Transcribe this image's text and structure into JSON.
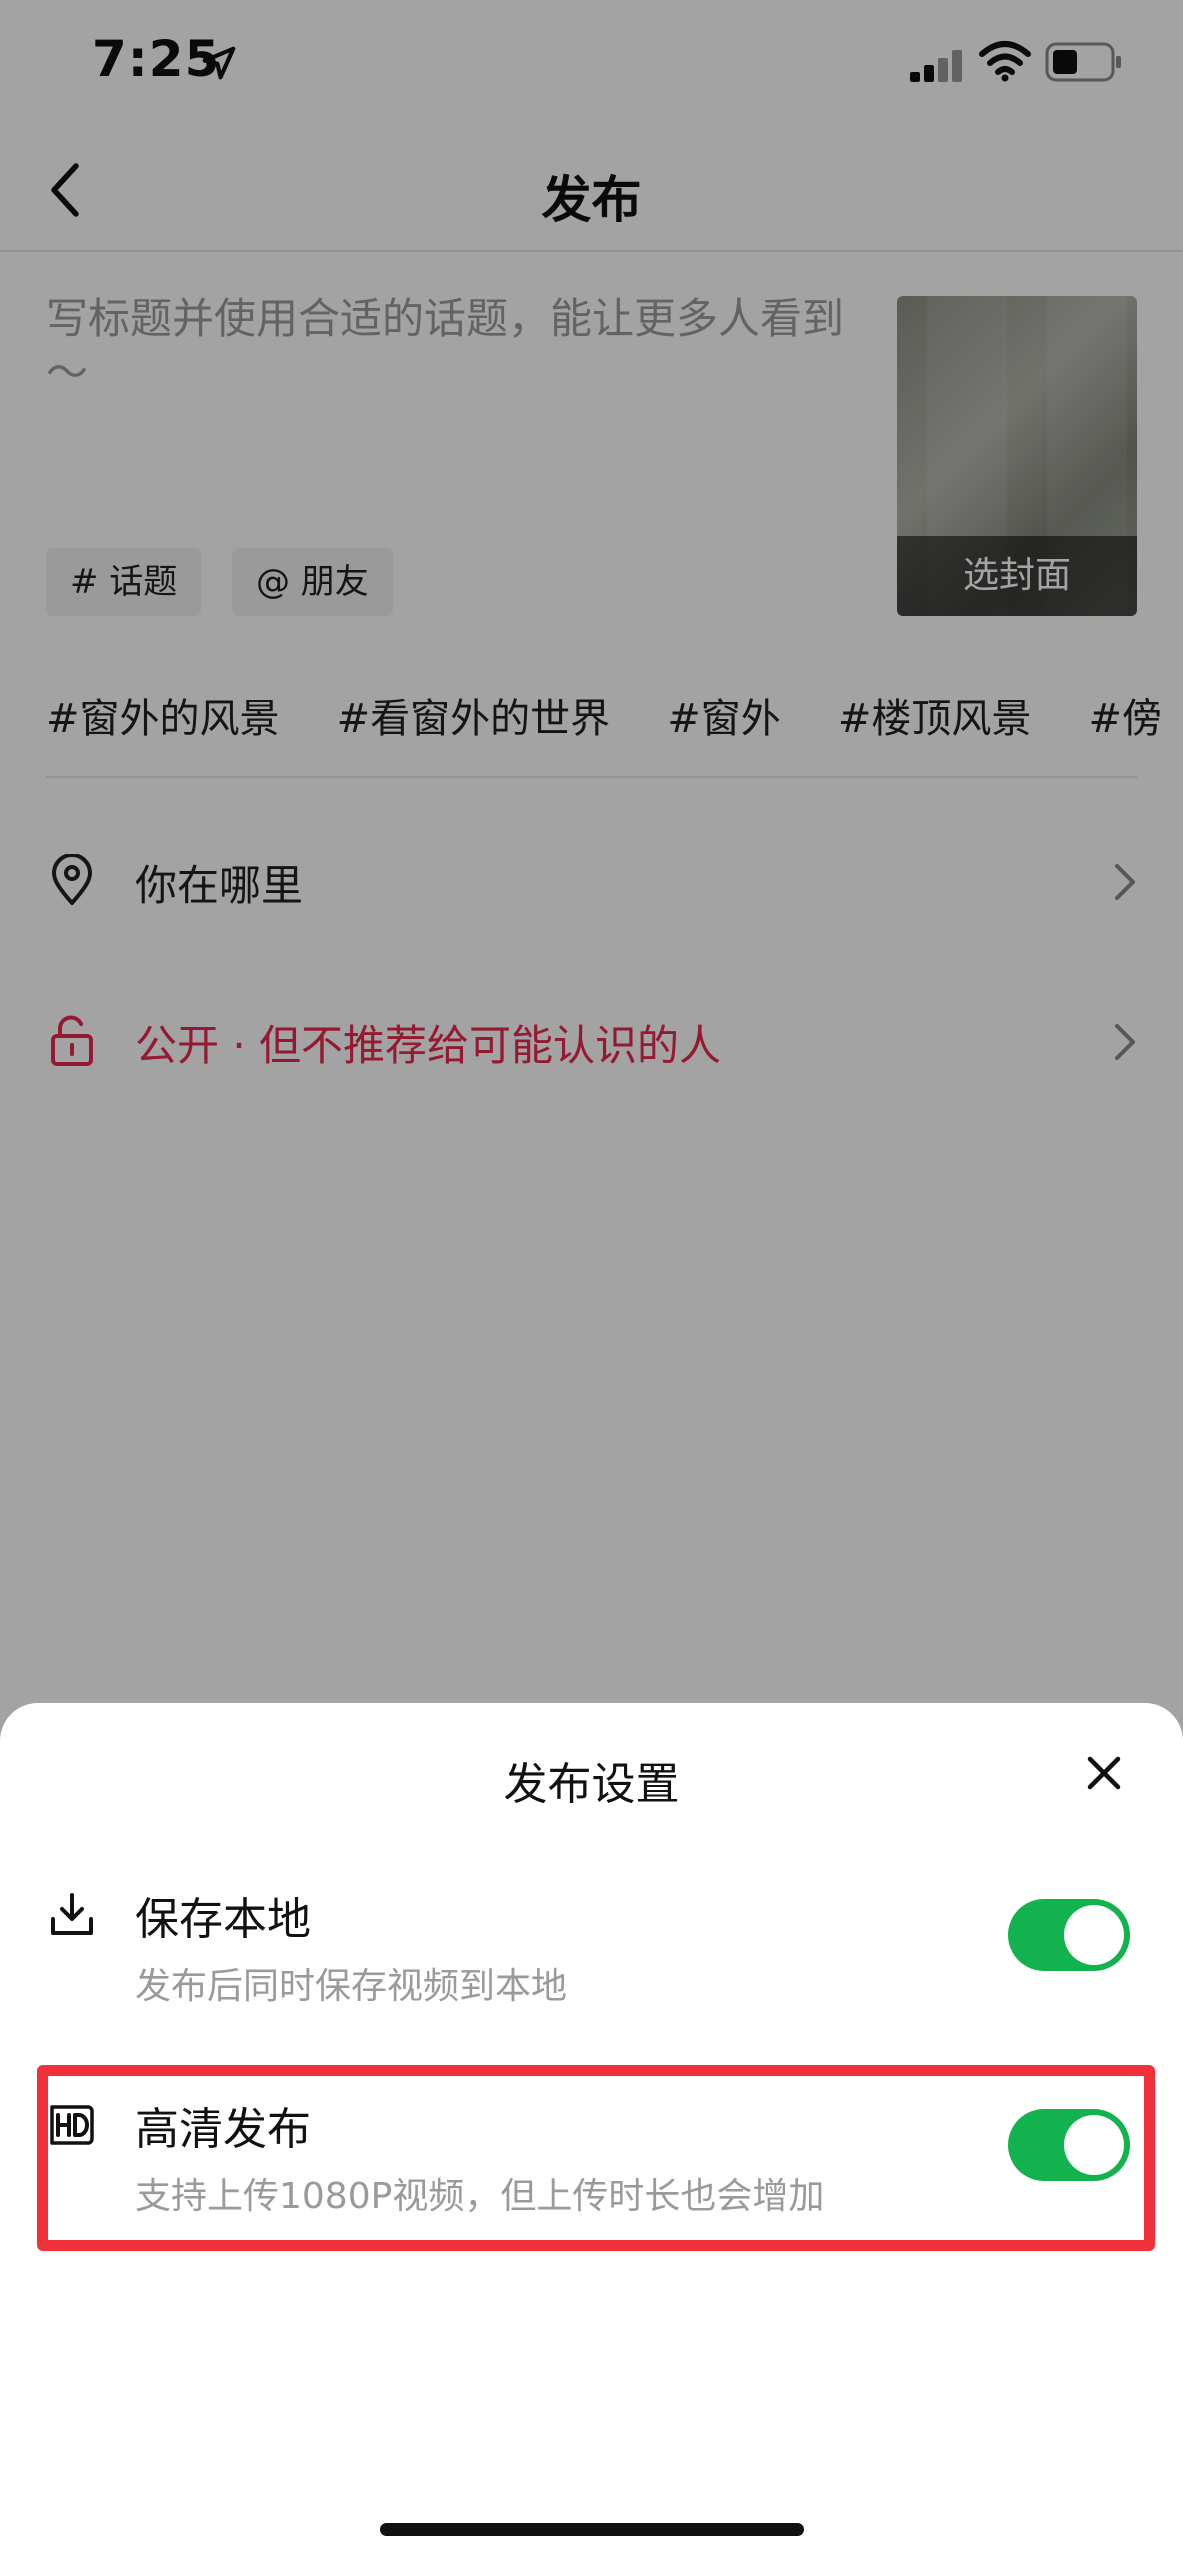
{
  "status_bar": {
    "time": "7:25"
  },
  "nav": {
    "title": "发布"
  },
  "caption": {
    "placeholder": "写标题并使用合适的话题，能让更多人看到～"
  },
  "cover": {
    "label": "选封面"
  },
  "chips": {
    "topic": "# 话题",
    "friend": "@ 朋友"
  },
  "suggestions": [
    "#窗外的风景",
    "#看窗外的世界",
    "#窗外",
    "#楼顶风景",
    "#傍"
  ],
  "rows": {
    "location": {
      "label": "你在哪里",
      "icon": "location-pin-icon"
    },
    "privacy": {
      "label": "公开 · 但不推荐给可能认识的人",
      "icon": "unlock-icon",
      "color": "#e8284e"
    }
  },
  "sheet": {
    "title": "发布设置",
    "settings": [
      {
        "title": "保存本地",
        "desc": "发布后同时保存视频到本地",
        "enabled": true,
        "icon": "download-icon"
      },
      {
        "title": "高清发布",
        "desc": "支持上传1080P视频，但上传时长也会增加",
        "enabled": true,
        "icon": "hd-icon"
      }
    ]
  },
  "colors": {
    "toggle_on": "#12b24f",
    "highlight": "#f1313a",
    "accent": "#e8284e"
  }
}
